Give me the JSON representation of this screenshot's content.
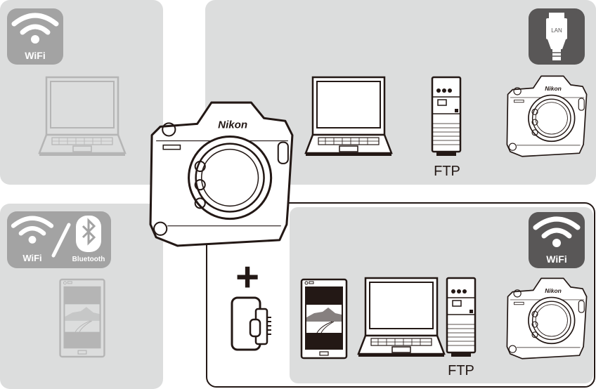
{
  "colors": {
    "panel": "#dcdddd",
    "badge_dark": "#595757",
    "badge_faded": "#a3a3a3",
    "line": "#231815",
    "line_faded": "#b5b5b5"
  },
  "panels": {
    "wifi_computer": {
      "badge_label": "WiFi",
      "icon": "wifi-icon",
      "device": "laptop"
    },
    "lan": {
      "badge_label": "LAN",
      "icon": "lan-cable-icon",
      "devices": [
        "laptop",
        "ftp-server",
        "camera"
      ],
      "ftp_label": "FTP"
    },
    "wifi_bluetooth": {
      "wifi_label": "WiFi",
      "bluetooth_label": "Bluetooth",
      "icons": [
        "wifi-icon",
        "bluetooth-icon"
      ],
      "device": "smartphone"
    },
    "wireless_transmitter": {
      "badge_label": "WiFi",
      "icon": "wifi-icon",
      "plus": "+",
      "devices": [
        "smartphone",
        "laptop",
        "ftp-server",
        "camera"
      ],
      "ftp_label": "FTP"
    }
  },
  "camera_logo": "Nikon"
}
